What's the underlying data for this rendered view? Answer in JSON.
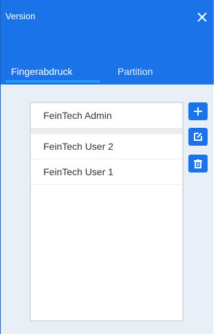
{
  "window": {
    "title": "Version"
  },
  "tabs": [
    {
      "label": "Fingerabdruck",
      "active": true
    },
    {
      "label": "Partition",
      "active": false
    }
  ],
  "user_list": {
    "items": [
      {
        "label": "FeinTech Admin",
        "selected": true
      },
      {
        "label": "FeinTech User 2",
        "selected": false
      },
      {
        "label": "FeinTech User 1",
        "selected": false
      }
    ]
  },
  "actions": {
    "add_icon": "plus-icon",
    "edit_icon": "edit-icon",
    "delete_icon": "trash-icon"
  },
  "colors": {
    "accent": "#1a73e8",
    "tab_indicator": "#24a1ff",
    "background": "#e9eff6"
  }
}
